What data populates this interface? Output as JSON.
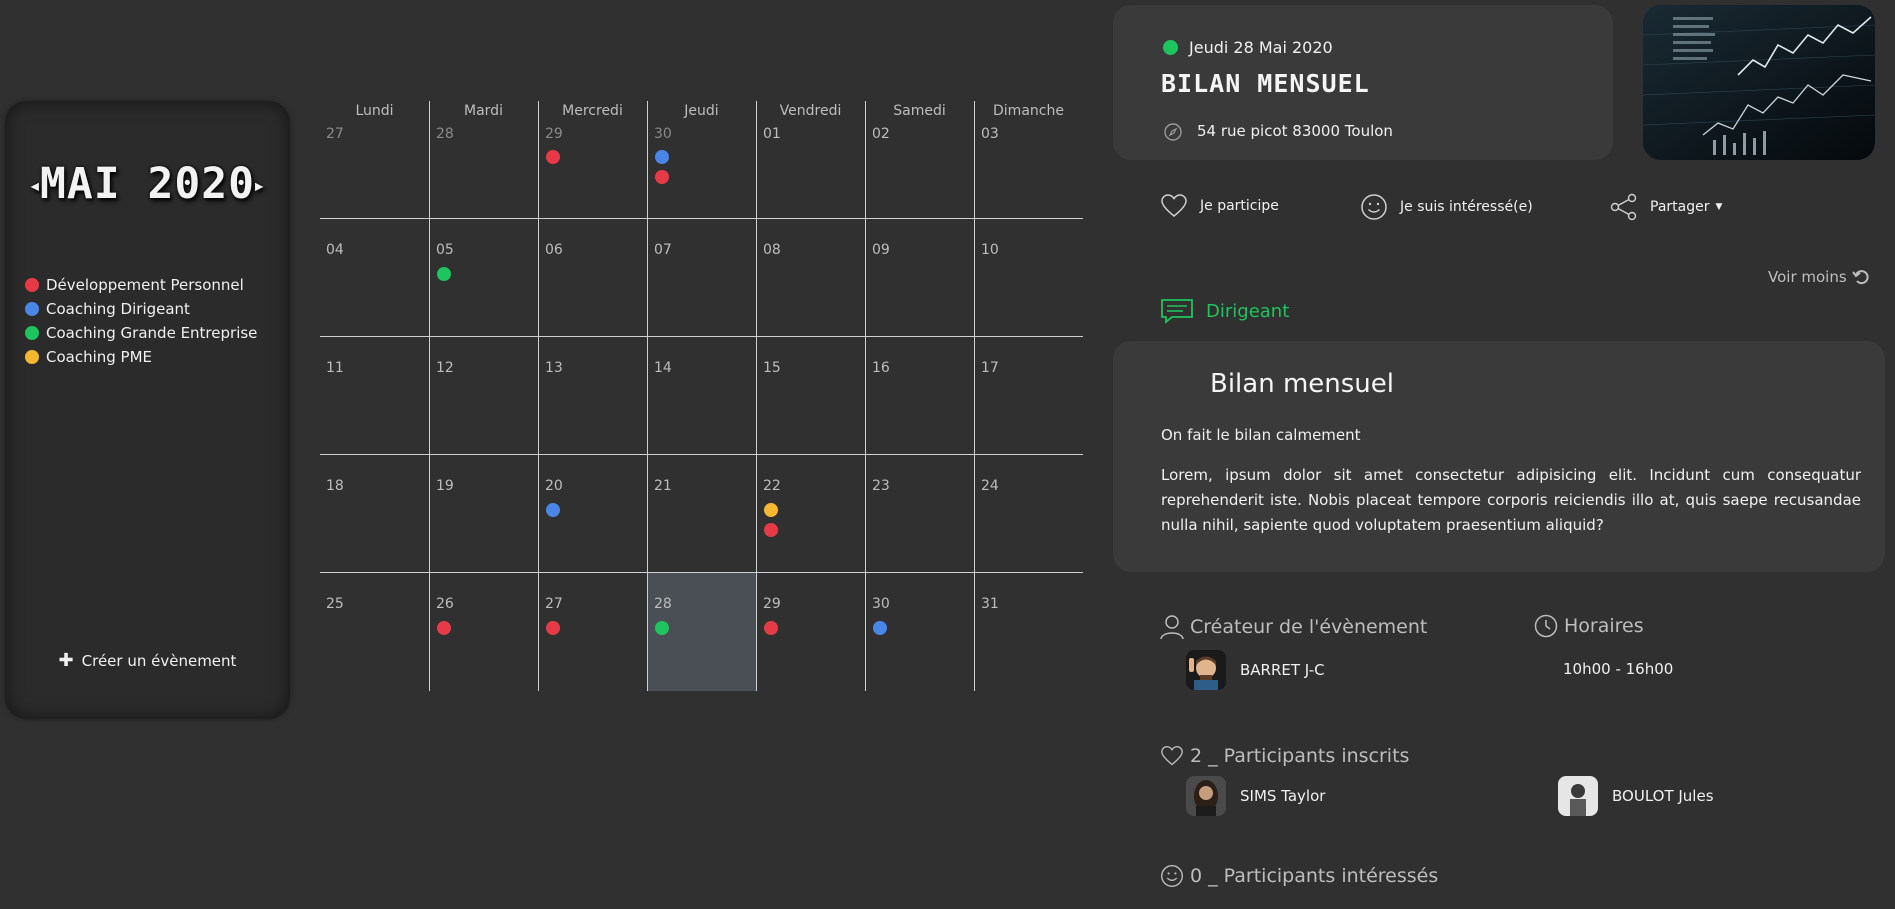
{
  "sidebar": {
    "month_title": "MAI 2020",
    "legend": [
      {
        "label": "Développement Personnel",
        "color": "#e63b47"
      },
      {
        "label": "Coaching Dirigeant",
        "color": "#4a86e8"
      },
      {
        "label": "Coaching Grande Entreprise",
        "color": "#1ec45e"
      },
      {
        "label": "Coaching PME",
        "color": "#f5b731"
      }
    ],
    "create_label": "Créer un évènement"
  },
  "calendar": {
    "weekdays": [
      "Lundi",
      "Mardi",
      "Mercredi",
      "Jeudi",
      "Vendredi",
      "Samedi",
      "Dimanche"
    ],
    "weeks": [
      [
        {
          "day": "27",
          "other": true,
          "events": []
        },
        {
          "day": "28",
          "other": true,
          "events": []
        },
        {
          "day": "29",
          "other": true,
          "events": [
            "#e63b47"
          ]
        },
        {
          "day": "30",
          "other": true,
          "events": [
            "#4a86e8",
            "#e63b47"
          ]
        },
        {
          "day": "01",
          "events": []
        },
        {
          "day": "02",
          "events": []
        },
        {
          "day": "03",
          "events": []
        }
      ],
      [
        {
          "day": "04",
          "events": []
        },
        {
          "day": "05",
          "events": [
            "#1ec45e"
          ]
        },
        {
          "day": "06",
          "events": []
        },
        {
          "day": "07",
          "events": []
        },
        {
          "day": "08",
          "events": []
        },
        {
          "day": "09",
          "events": []
        },
        {
          "day": "10",
          "events": []
        }
      ],
      [
        {
          "day": "11",
          "events": []
        },
        {
          "day": "12",
          "events": []
        },
        {
          "day": "13",
          "events": []
        },
        {
          "day": "14",
          "events": []
        },
        {
          "day": "15",
          "events": []
        },
        {
          "day": "16",
          "events": []
        },
        {
          "day": "17",
          "events": []
        }
      ],
      [
        {
          "day": "18",
          "events": []
        },
        {
          "day": "19",
          "events": []
        },
        {
          "day": "20",
          "events": [
            "#4a86e8"
          ]
        },
        {
          "day": "21",
          "events": []
        },
        {
          "day": "22",
          "events": [
            "#f5b731",
            "#e63b47"
          ]
        },
        {
          "day": "23",
          "events": []
        },
        {
          "day": "24",
          "events": []
        }
      ],
      [
        {
          "day": "25",
          "events": []
        },
        {
          "day": "26",
          "events": [
            "#e63b47"
          ]
        },
        {
          "day": "27",
          "events": [
            "#e63b47"
          ]
        },
        {
          "day": "28",
          "selected": true,
          "events": [
            "#1ec45e"
          ]
        },
        {
          "day": "29",
          "events": [
            "#e63b47"
          ]
        },
        {
          "day": "30",
          "events": [
            "#4a86e8"
          ]
        },
        {
          "day": "31",
          "events": []
        }
      ]
    ]
  },
  "event": {
    "status_color": "#1ec45e",
    "date": "Jeudi 28 Mai 2020",
    "title": "BILAN MENSUEL",
    "address": "54 rue picot 83000 Toulon",
    "photo_icon": "stock-chart-photo"
  },
  "actions": {
    "participate": "Je participe",
    "interested": "Je suis intéressé(e)",
    "share": "Partager"
  },
  "voir_moins": "Voir moins",
  "category": {
    "label": "Dirigeant",
    "color": "#1ec45e"
  },
  "description": {
    "heading": "Bilan mensuel",
    "subtitle": "On fait le bilan calmement",
    "body": "Lorem, ipsum dolor sit amet consectetur adipisicing elit. Incidunt cum consequatur reprehenderit iste. Nobis placeat tempore corporis reiciendis illo at, quis saepe recusandae nulla nihil, sapiente quod voluptatem praesentium aliquid?"
  },
  "creator": {
    "heading": "Créateur de l'évènement",
    "name": "BARRET J-C"
  },
  "horaires": {
    "heading": "Horaires",
    "value": "10h00 - 16h00"
  },
  "participants": {
    "heading": "2 _ Participants inscrits",
    "list": [
      {
        "name": "SIMS Taylor"
      },
      {
        "name": "BOULOT Jules"
      }
    ]
  },
  "interested": {
    "heading": "0 _ Participants intéressés"
  }
}
